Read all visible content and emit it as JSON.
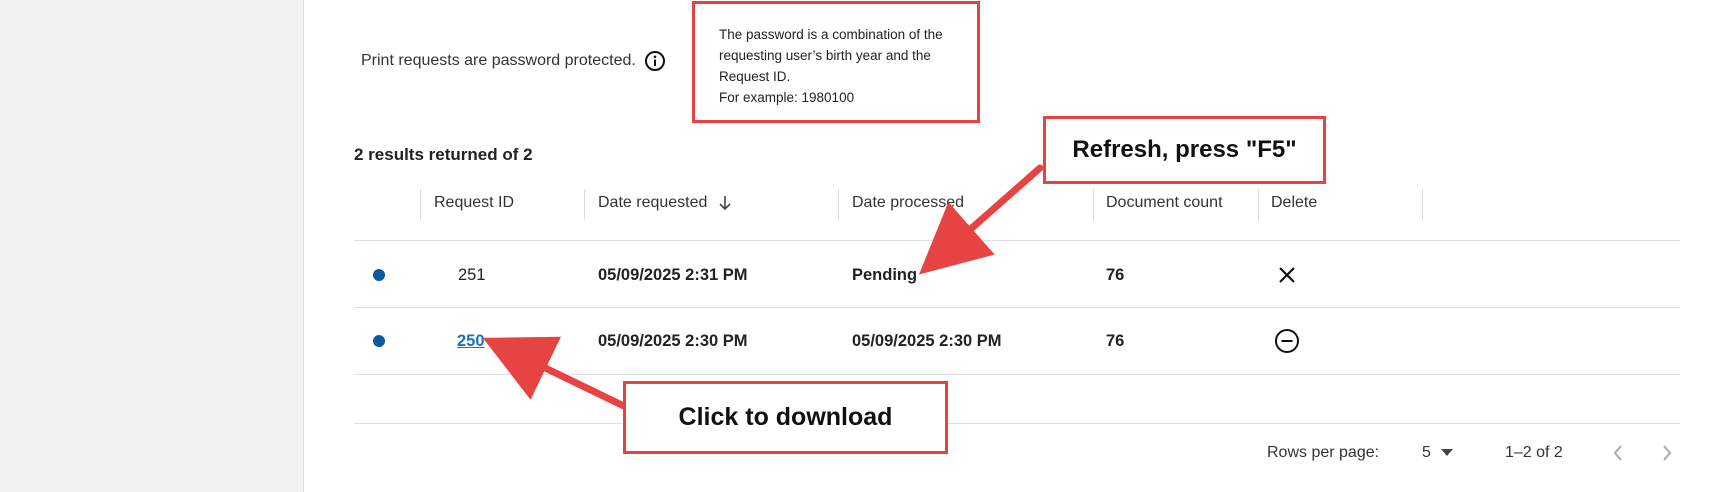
{
  "notice": {
    "text": "Print requests are password protected.",
    "icon": "info-icon"
  },
  "tooltip": {
    "lines": [
      "The password is a combination of the",
      "requesting user’s birth year and the",
      "Request ID.",
      "For example: 1980100"
    ]
  },
  "results": {
    "summary": "2 results returned of 2"
  },
  "table": {
    "headers": [
      "Request ID",
      "Date requested",
      "Date processed",
      "Document count",
      "Delete"
    ],
    "sort_icon": "arrow-down-icon",
    "rows": [
      {
        "request_id": "251",
        "date_requested": "05/09/2025 2:31 PM",
        "date_processed": "Pending",
        "document_count": "76",
        "delete_icon": "close-icon",
        "id_is_link": false
      },
      {
        "request_id": "250",
        "date_requested": "05/09/2025 2:30 PM",
        "date_processed": "05/09/2025 2:30 PM",
        "document_count": "76",
        "delete_icon": "minus-circle-icon",
        "id_is_link": true
      }
    ]
  },
  "pagination": {
    "rows_per_page_label": "Rows per page:",
    "rows_per_page_value": "5",
    "range": "1–2 of 2"
  },
  "callouts": {
    "refresh": "Refresh, press \"F5\"",
    "download": "Click to download"
  },
  "colors": {
    "accent_red": "#e84343",
    "link_blue": "#1a73c8",
    "status_dot": "#0b5a9e"
  }
}
